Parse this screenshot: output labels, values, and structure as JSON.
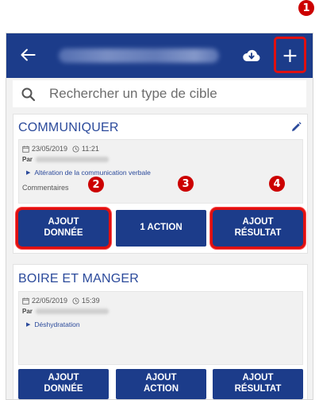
{
  "annotations": {
    "badge_1": "1",
    "badge_2": "2",
    "badge_3": "3",
    "badge_4": "4"
  },
  "colors": {
    "primary": "#1c3c8a",
    "accent_title": "#2b4a9b",
    "highlight": "#e01010"
  },
  "header": {
    "back_icon": "arrow-left-icon",
    "cloud_icon": "cloud-download-icon",
    "add_label": "+"
  },
  "search": {
    "placeholder": "Rechercher un type de cible"
  },
  "cards": [
    {
      "title": "COMMUNIQUER",
      "date": "23/05/2019",
      "time": "11:21",
      "par_label": "Par",
      "diagnostic": "Altération de la communication verbale",
      "comment_label": "Commentaires",
      "buttons": {
        "add_data": [
          "AJOUT",
          "DONNÉE"
        ],
        "action": "1 ACTION",
        "add_result": [
          "AJOUT",
          "RÉSULTAT"
        ]
      }
    },
    {
      "title": "BOIRE ET MANGER",
      "date": "22/05/2019",
      "time": "15:39",
      "par_label": "Par",
      "diagnostic": "Déshydratation",
      "buttons": {
        "add_data": [
          "AJOUT",
          "DONNÉE"
        ],
        "action": [
          "AJOUT",
          "ACTION"
        ],
        "add_result": [
          "AJOUT",
          "RÉSULTAT"
        ]
      }
    }
  ]
}
